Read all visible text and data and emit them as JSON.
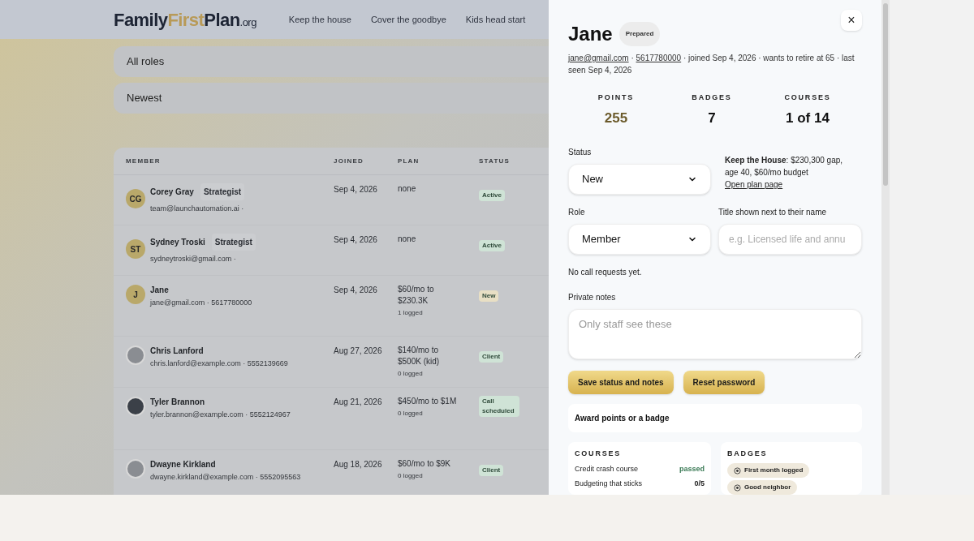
{
  "header": {
    "logo": {
      "part_1": "Family",
      "part_2": "First",
      "part_3": "Plan",
      "suffix": ".org"
    },
    "nav": [
      {
        "label": "Keep the house"
      },
      {
        "label": "Cover the goodbye"
      },
      {
        "label": "Kids head start"
      }
    ]
  },
  "filters": [
    {
      "value": "All roles"
    },
    {
      "value": "Newest"
    }
  ],
  "table": {
    "columns": [
      "MEMBER",
      "JOINED",
      "PLAN",
      "STATUS"
    ],
    "rows": [
      {
        "avatar": {
          "kind": "initials",
          "text": "CG"
        },
        "name": "Corey Gray",
        "title": "Strategist",
        "contact": "team@launchautomation.ai ·",
        "joined": "Sep 4, 2026",
        "plan": [
          "none"
        ],
        "status": {
          "label": "Active",
          "color": "#cfe3d6"
        }
      },
      {
        "avatar": {
          "kind": "initials",
          "text": "ST"
        },
        "name": "Sydney Troski",
        "title": "Strategist",
        "contact": "sydneytroski@gmail.com ·",
        "joined": "Sep 4, 2026",
        "plan": [
          "none"
        ],
        "status": {
          "label": "Active",
          "color": "#cfe3d6"
        }
      },
      {
        "avatar": {
          "kind": "initials",
          "text": "J"
        },
        "name": "Jane",
        "contact": "jane@gmail.com · 5617780000",
        "joined": "Sep 4, 2026",
        "plan": [
          "$60/mo to",
          "$230.3K"
        ],
        "logged": "1 logged",
        "status": {
          "label": "New",
          "color": "#e8dfc4"
        }
      },
      {
        "avatar": {
          "kind": "photo"
        },
        "name": "Chris Lanford",
        "contact": "chris.lanford@example.com · 5552139669",
        "joined": "Aug 27, 2026",
        "plan": [
          "$140/mo to",
          "$500K (kid)"
        ],
        "logged": "0 logged",
        "status": {
          "label": "Client",
          "color": "#cfe3d6"
        }
      },
      {
        "avatar": {
          "kind": "photo"
        },
        "name": "Tyler Brannon",
        "contact": "tyler.brannon@example.com · 5552124967",
        "joined": "Aug 21, 2026",
        "plan": [
          "$450/mo to $1M"
        ],
        "logged": "0 logged",
        "status": {
          "label": "Call scheduled",
          "color": "#cfe3d6"
        }
      },
      {
        "avatar": {
          "kind": "photo"
        },
        "name": "Dwayne Kirkland",
        "contact": "dwayne.kirkland@example.com · 5552095563",
        "joined": "Aug 18, 2026",
        "plan": [
          "$60/mo to $9K"
        ],
        "logged": "0 logged",
        "status": {
          "label": "Client",
          "color": "#cfe3d6"
        }
      }
    ]
  },
  "drawer": {
    "name": "Jane",
    "tag": "Prepared",
    "close": "×",
    "email": "jane@gmail.com",
    "separator": "·",
    "phone": "5617780000",
    "meta": "· joined Sep 4, 2026 · wants to retire at 65 · last seen Sep 4, 2026",
    "stats": [
      {
        "label": "POINTS",
        "value": "255",
        "kind": "accent"
      },
      {
        "label": "BADGES",
        "value": "7",
        "kind": "plain"
      },
      {
        "label": "COURSES",
        "value": "1 of 14",
        "kind": "plain"
      }
    ],
    "status_field": {
      "label": "Status",
      "value": "New"
    },
    "plan_summary": {
      "text": "**Keep the House**: $230,300 gap, age 40, $60/mo budget",
      "link": "Open plan page"
    },
    "role_field": {
      "label": "Role",
      "value": "Member"
    },
    "title_field": {
      "label": "Title shown next to their name",
      "placeholder": "e.g. Licensed life and annu"
    },
    "call_note": "No call requests yet.",
    "notes_field": {
      "label": "Private notes",
      "placeholder": "Only staff see these"
    },
    "buttons": [
      "Save status and notes",
      "Reset password"
    ],
    "award": "Award points or a badge",
    "courses": {
      "heading": "COURSES",
      "items": [
        {
          "name": "Credit crash course",
          "progress": "passed",
          "passed": true
        },
        {
          "name": "Budgeting that sticks",
          "progress": "0/5",
          "passed": false
        }
      ]
    },
    "badges": {
      "heading": "BADGES",
      "items": [
        {
          "label": "First month logged"
        },
        {
          "label": "Good neighbor"
        }
      ]
    }
  }
}
